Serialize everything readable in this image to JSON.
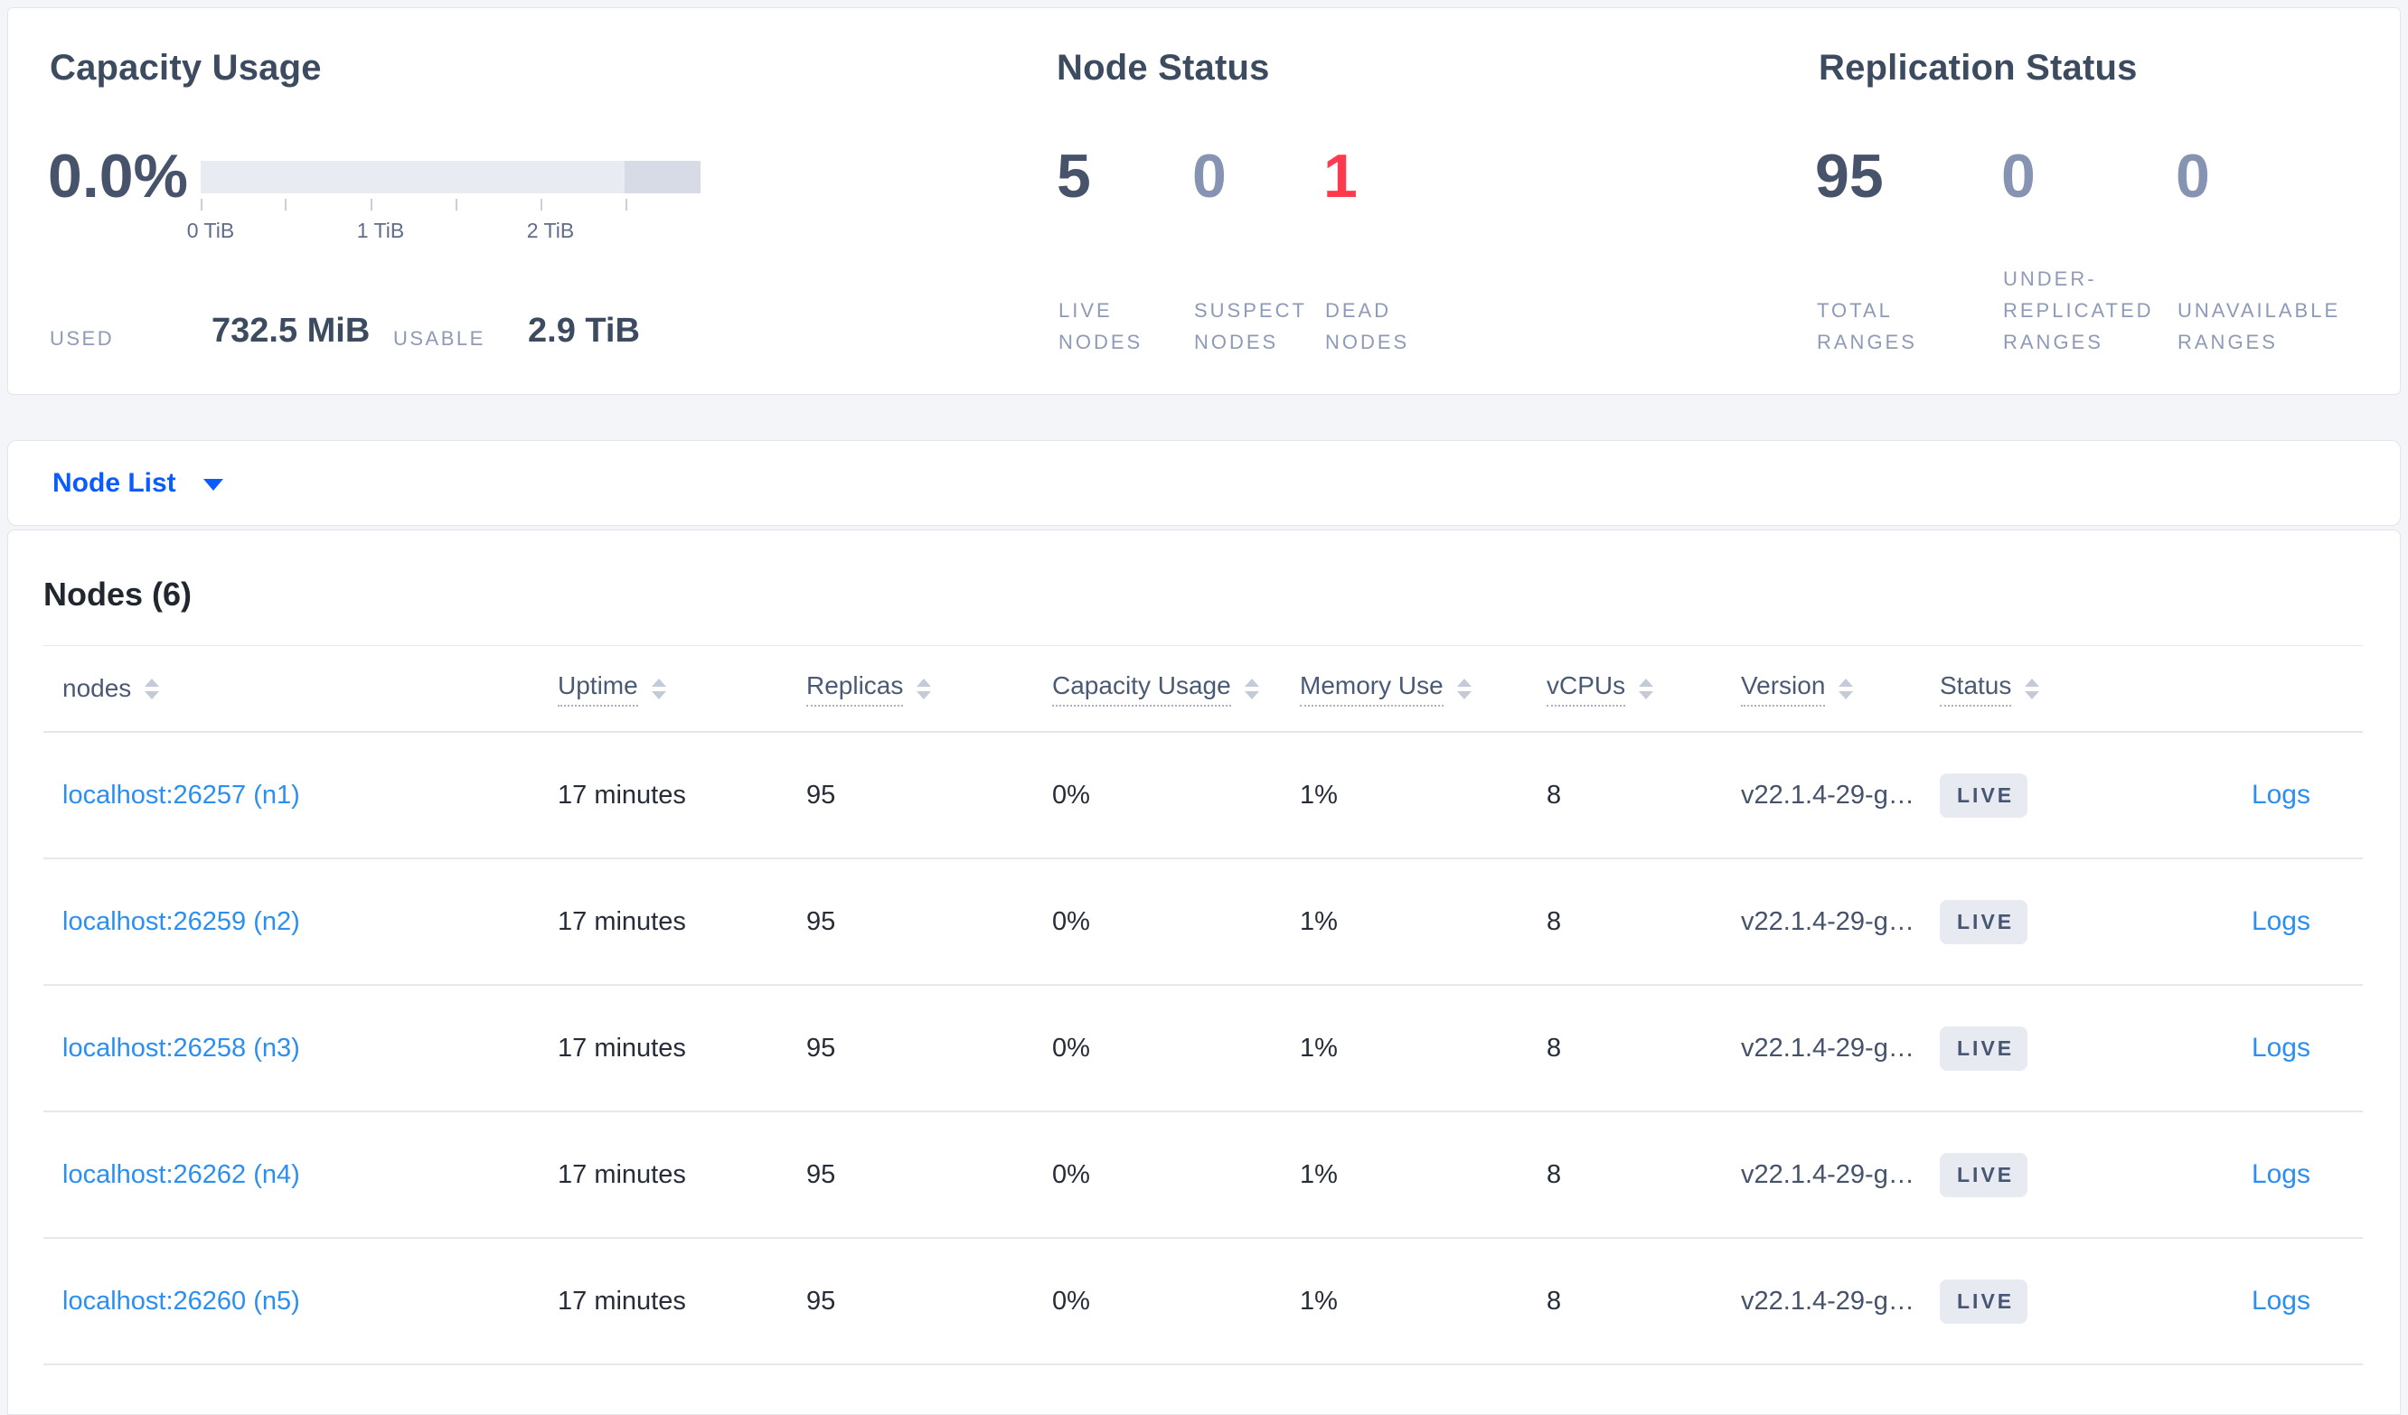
{
  "summary": {
    "capacity": {
      "title": "Capacity Usage",
      "percent_used": "0.0%",
      "tick_labels": [
        "0 TiB",
        "1 TiB",
        "2 TiB"
      ],
      "used_label": "USED",
      "used_value": "732.5 MiB",
      "usable_label": "USABLE",
      "usable_value": "2.9 TiB"
    },
    "node_status": {
      "title": "Node Status",
      "metrics": [
        {
          "value": "5",
          "tone": "dark",
          "label_lines": [
            "LIVE",
            "NODES"
          ]
        },
        {
          "value": "0",
          "tone": "muted",
          "label_lines": [
            "SUSPECT",
            "NODES"
          ]
        },
        {
          "value": "1",
          "tone": "danger",
          "label_lines": [
            "DEAD",
            "NODES"
          ]
        }
      ]
    },
    "replication_status": {
      "title": "Replication Status",
      "metrics": [
        {
          "value": "95",
          "tone": "dark",
          "label_lines": [
            "TOTAL",
            "RANGES"
          ]
        },
        {
          "value": "0",
          "tone": "muted",
          "label_lines": [
            "UNDER-",
            "REPLICATED",
            "RANGES"
          ]
        },
        {
          "value": "0",
          "tone": "muted",
          "label_lines": [
            "UNAVAILABLE",
            "RANGES"
          ]
        }
      ]
    }
  },
  "view_selector": {
    "label": "Node List",
    "icon": "caret-down-icon"
  },
  "nodes_section": {
    "heading": "Nodes (6)",
    "columns": [
      {
        "label": "nodes",
        "underlined": false
      },
      {
        "label": "Uptime",
        "underlined": true
      },
      {
        "label": "Replicas",
        "underlined": true
      },
      {
        "label": "Capacity Usage",
        "underlined": true
      },
      {
        "label": "Memory Use",
        "underlined": true
      },
      {
        "label": "vCPUs",
        "underlined": true
      },
      {
        "label": "Version",
        "underlined": true
      },
      {
        "label": "Status",
        "underlined": true
      },
      {
        "label": "",
        "underlined": false
      }
    ],
    "logs_label": "Logs",
    "rows": [
      {
        "address": "localhost:26257 (n1)",
        "uptime": "17 minutes",
        "replicas": "95",
        "capacity_usage": "0%",
        "memory_use": "1%",
        "vcpus": "8",
        "version": "v22.1.4-29-g…",
        "status": "LIVE"
      },
      {
        "address": "localhost:26259 (n2)",
        "uptime": "17 minutes",
        "replicas": "95",
        "capacity_usage": "0%",
        "memory_use": "1%",
        "vcpus": "8",
        "version": "v22.1.4-29-g…",
        "status": "LIVE"
      },
      {
        "address": "localhost:26258 (n3)",
        "uptime": "17 minutes",
        "replicas": "95",
        "capacity_usage": "0%",
        "memory_use": "1%",
        "vcpus": "8",
        "version": "v22.1.4-29-g…",
        "status": "LIVE"
      },
      {
        "address": "localhost:26262 (n4)",
        "uptime": "17 minutes",
        "replicas": "95",
        "capacity_usage": "0%",
        "memory_use": "1%",
        "vcpus": "8",
        "version": "v22.1.4-29-g…",
        "status": "LIVE"
      },
      {
        "address": "localhost:26260 (n5)",
        "uptime": "17 minutes",
        "replicas": "95",
        "capacity_usage": "0%",
        "memory_use": "1%",
        "vcpus": "8",
        "version": "v22.1.4-29-g…",
        "status": "LIVE"
      }
    ]
  },
  "colors": {
    "page_bg": "#f4f5f9",
    "action_blue": "#0b5cff",
    "link_blue": "#2b8ff2",
    "danger_red": "#ff3a4f",
    "metric_dark": "#46536b",
    "metric_muted": "#8793b3",
    "badge_bg": "#e7eaf1",
    "bar_track": "#e9ebf3",
    "bar_dark_segment": "#d7dbe5"
  }
}
